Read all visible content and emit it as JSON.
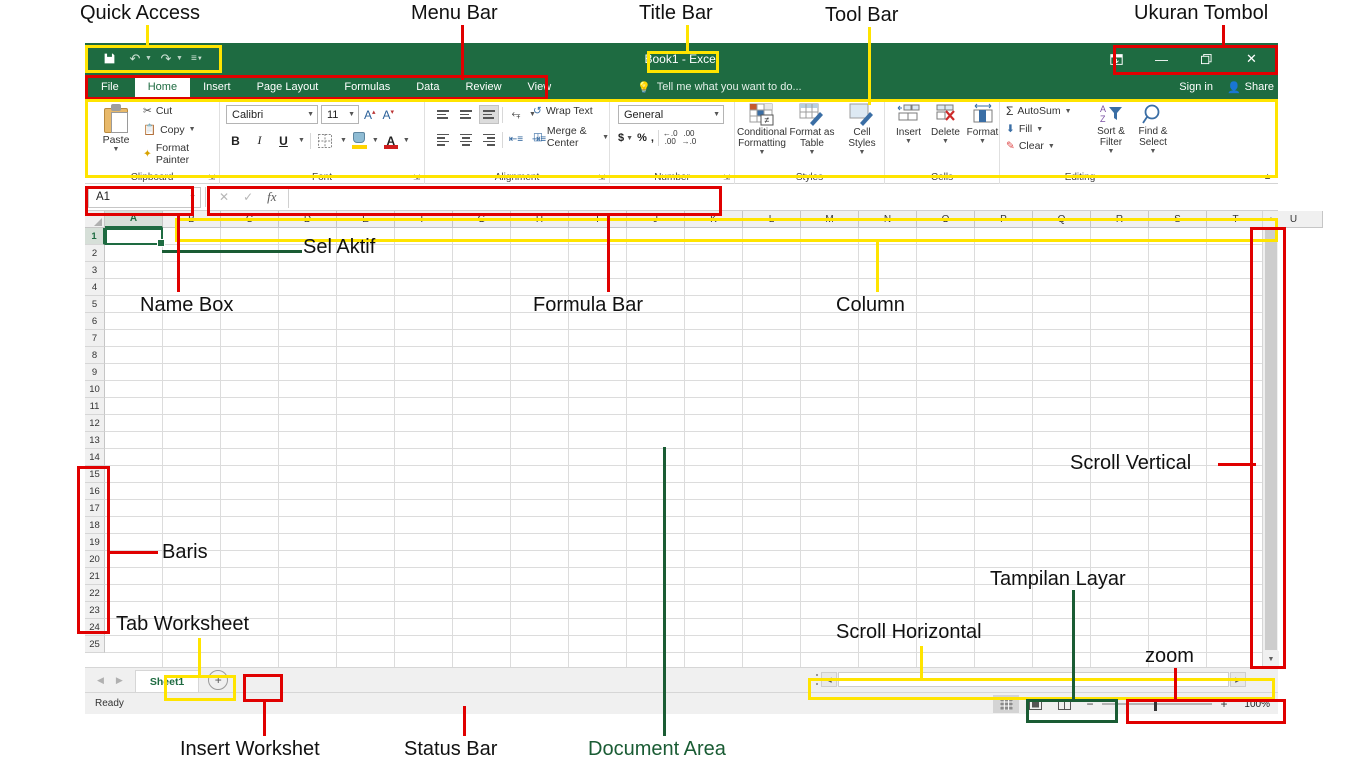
{
  "window": {
    "title": "Book1 - Excel",
    "quick_access": [
      {
        "name": "save",
        "glyph": "Ὃe",
        "label": "Save"
      },
      {
        "name": "undo",
        "glyph": "↶",
        "label": "Undo"
      },
      {
        "name": "redo",
        "glyph": "↷",
        "label": "Redo"
      },
      {
        "name": "customize",
        "glyph": "≡",
        "label": "Customize Quick Access Toolbar"
      }
    ],
    "controls": [
      {
        "name": "ribbon-display-options",
        "glyph": "⬒"
      },
      {
        "name": "minimize",
        "glyph": "─"
      },
      {
        "name": "restore",
        "glyph": "❐"
      },
      {
        "name": "close",
        "glyph": "✕"
      }
    ]
  },
  "menu": {
    "tabs": [
      "File",
      "Home",
      "Insert",
      "Page Layout",
      "Formulas",
      "Data",
      "Review",
      "View"
    ],
    "active_tab": "Home",
    "tellme": "Tell me what you want to do...",
    "signin": "Sign in",
    "share": "Share"
  },
  "ribbon": {
    "groups": [
      {
        "name": "Clipboard",
        "paste": "Paste",
        "items": [
          "Cut",
          "Copy",
          "Format Painter"
        ]
      },
      {
        "name": "Font",
        "font_name": "Calibri",
        "font_size": "11",
        "buttons": [
          "B",
          "I",
          "U"
        ]
      },
      {
        "name": "Alignment",
        "wrap_text": "Wrap Text",
        "merge_center": "Merge & Center"
      },
      {
        "name": "Number",
        "format": "General",
        "buttons": [
          "$",
          "%",
          ","
        ]
      },
      {
        "name": "Styles",
        "items": [
          "Conditional Formatting",
          "Format as Table",
          "Cell Styles"
        ]
      },
      {
        "name": "Cells",
        "items": [
          "Insert",
          "Delete",
          "Format"
        ]
      },
      {
        "name": "Editing",
        "small_items": [
          "AutoSum",
          "Fill",
          "Clear"
        ],
        "large_items": [
          "Sort & Filter",
          "Find & Select"
        ]
      }
    ]
  },
  "formula_bar": {
    "name_box": "A1",
    "value": "",
    "cancel": "✕",
    "enter": "✓",
    "fx": "fx"
  },
  "sheet": {
    "columns": [
      "A",
      "B",
      "C",
      "D",
      "E",
      "F",
      "G",
      "H",
      "I",
      "J",
      "K",
      "L",
      "M",
      "N",
      "O",
      "P",
      "Q",
      "R",
      "S",
      "T",
      "U"
    ],
    "rows": [
      1,
      2,
      3,
      4,
      5,
      6,
      7,
      8,
      9,
      10,
      11,
      12,
      13,
      14,
      15,
      16,
      17,
      18,
      19,
      20,
      21,
      22,
      23,
      24,
      25
    ],
    "active_cell": "A1",
    "tabs": [
      "Sheet1"
    ],
    "add_sheet": "+"
  },
  "status": {
    "text": "Ready",
    "views": [
      {
        "name": "normal-view",
        "glyph": "▦"
      },
      {
        "name": "page-layout-view",
        "glyph": "▣"
      },
      {
        "name": "page-break-view",
        "glyph": "▤"
      }
    ],
    "zoom": "100%",
    "zoom_out": "−",
    "zoom_in": "+"
  },
  "annotations": [
    {
      "id": "quick-access",
      "text": "Quick Access",
      "color": "black"
    },
    {
      "id": "menu-bar",
      "text": "Menu Bar",
      "color": "black"
    },
    {
      "id": "title-bar",
      "text": "Title Bar",
      "color": "black"
    },
    {
      "id": "tool-bar",
      "text": "Tool Bar",
      "color": "black"
    },
    {
      "id": "ukuran-tombol",
      "text": "Ukuran Tombol",
      "color": "black"
    },
    {
      "id": "sel-aktif",
      "text": "Sel Aktif",
      "color": "black"
    },
    {
      "id": "name-box",
      "text": "Name Box",
      "color": "black"
    },
    {
      "id": "formula-bar",
      "text": "Formula Bar",
      "color": "black"
    },
    {
      "id": "column",
      "text": "Column",
      "color": "black"
    },
    {
      "id": "scroll-vertical",
      "text": "Scroll Vertical",
      "color": "black"
    },
    {
      "id": "baris",
      "text": "Baris",
      "color": "black"
    },
    {
      "id": "tab-worksheet",
      "text": "Tab Worksheet",
      "color": "black"
    },
    {
      "id": "tampilan-layar",
      "text": "Tampilan Layar",
      "color": "black"
    },
    {
      "id": "scroll-horizontal",
      "text": "Scroll Horizontal",
      "color": "black"
    },
    {
      "id": "zoom",
      "text": "zoom",
      "color": "black"
    },
    {
      "id": "insert-worksheet",
      "text": "Insert Workshet",
      "color": "black"
    },
    {
      "id": "status-bar",
      "text": "Status Bar",
      "color": "black"
    },
    {
      "id": "document-area",
      "text": "Document Area",
      "color": "green"
    }
  ]
}
